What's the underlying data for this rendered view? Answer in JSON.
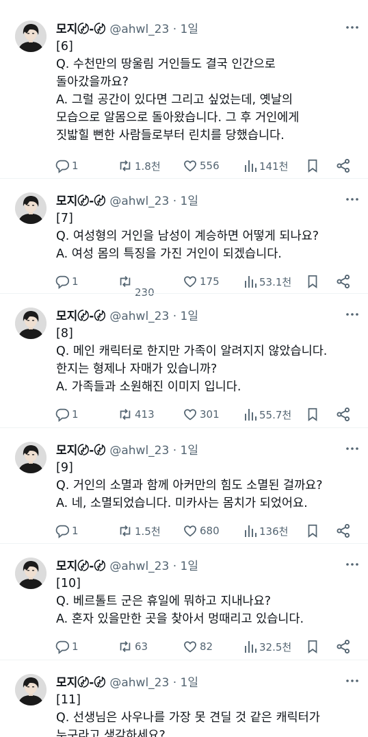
{
  "colors": {
    "text": "#0f1419",
    "secondary": "#536471",
    "background": "#ffffff"
  },
  "icons": {
    "reply": "reply-icon",
    "retweet": "retweet-icon",
    "like": "heart-icon",
    "views": "views-bar-icon",
    "bookmark": "bookmark-icon",
    "share": "share-icon",
    "more": "more-icon"
  },
  "tweets": [
    {
      "username": "모지〄-〄",
      "handle": "@ahwl_23 · 1일",
      "lines": [
        "[6]",
        "Q. 수천만의 땅울림 거인들도 결국 인간으로",
        "돌아갔을까요?",
        "A. 그럴 공간이 있다면 그리고 싶었는데, 옛날의",
        "모습으로 알몸으로 돌아왔습니다. 그 후 거인에게",
        "짓밟힐 뻔한 사람들로부터 린치를 당했습니다."
      ],
      "replies": "1",
      "retweets": "1.8천",
      "likes": "556",
      "views": "141천"
    },
    {
      "username": "모지〄-〄",
      "handle": "@ahwl_23 · 1일",
      "lines": [
        "[7]",
        "Q. 여성형의 거인을 남성이 계승하면 어떻게 되나요?",
        "A. 여성 몸의 특징을 가진 거인이 되겠습니다."
      ],
      "replies": "1",
      "retweets": "230",
      "likes": "175",
      "views": "53.1천"
    },
    {
      "username": "모지〄-〄",
      "handle": "@ahwl_23 · 1일",
      "lines": [
        "[8]",
        "Q. 메인 캐릭터로 한지만 가족이 알려지지 않았습니다.",
        "한지는 형제나 자매가 있습니까?",
        "A. 가족들과 소원해진 이미지 입니다."
      ],
      "replies": "1",
      "retweets": "413",
      "likes": "301",
      "views": "55.7천"
    },
    {
      "username": "모지〄-〄",
      "handle": "@ahwl_23 · 1일",
      "lines": [
        "[9]",
        "Q. 거인의 소멸과 함께 아커만의 힘도 소멸된 걸까요?",
        "A. 네, 소멸되었습니다. 미카사는 몸치가 되었어요."
      ],
      "replies": "1",
      "retweets": "1.5천",
      "likes": "680",
      "views": "136천"
    },
    {
      "username": "모지〄-〄",
      "handle": "@ahwl_23 · 1일",
      "lines": [
        "[10]",
        "Q. 베르톨트 군은 휴일에 뭐하고 지내나요?",
        "A. 혼자 있을만한 곳을 찾아서 멍때리고 있습니다."
      ],
      "replies": "1",
      "retweets": "63",
      "likes": "82",
      "views": "32.5천"
    },
    {
      "username": "모지〄-〄",
      "handle": "@ahwl_23 · 1일",
      "lines": [
        "[11]",
        "Q. 선생님은 사우나를 가장 못 견딜 것 같은 캐릭터가",
        "누구라고 생각하세요?"
      ]
    }
  ]
}
